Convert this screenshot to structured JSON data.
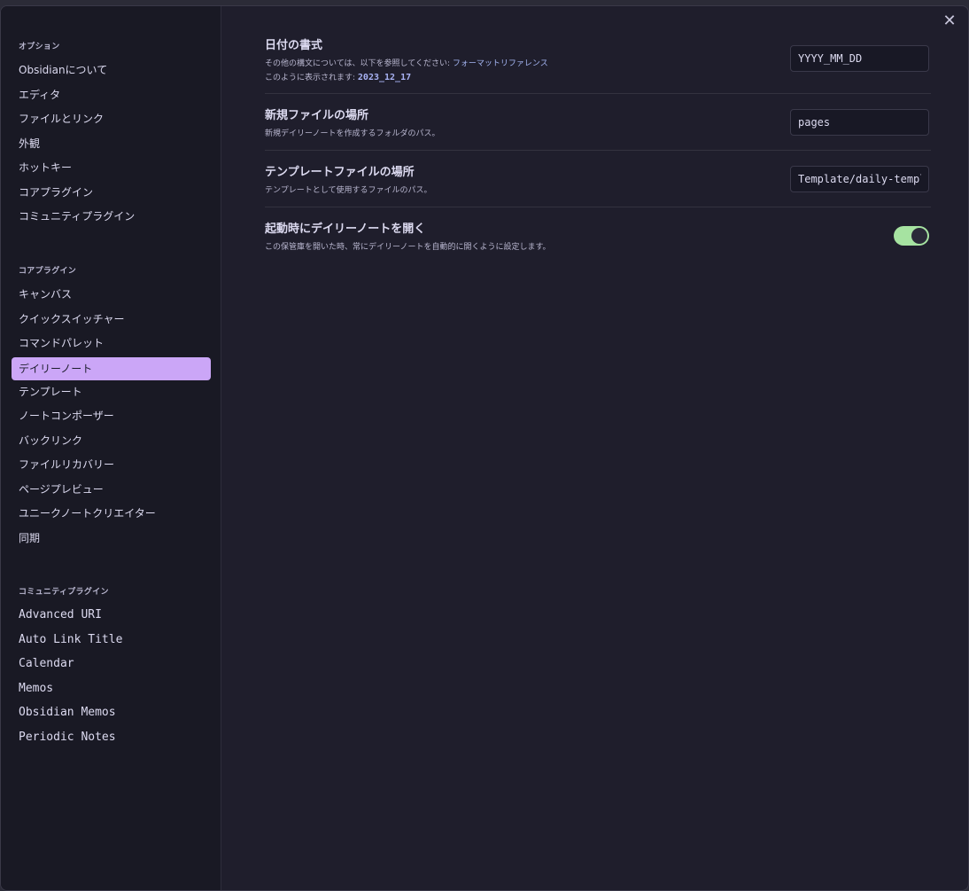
{
  "close_label": "✕",
  "sidebar": {
    "groups": [
      {
        "title": "オプション",
        "items": [
          "Obsidianについて",
          "エディタ",
          "ファイルとリンク",
          "外観",
          "ホットキー",
          "コアプラグイン",
          "コミュニティプラグイン"
        ]
      },
      {
        "title": "コアプラグイン",
        "items": [
          "キャンバス",
          "クイックスイッチャー",
          "コマンドパレット",
          "デイリーノート",
          "テンプレート",
          "ノートコンポーザー",
          "バックリンク",
          "ファイルリカバリー",
          "ページプレビュー",
          "ユニークノートクリエイター",
          "同期"
        ]
      },
      {
        "title": "コミュニティプラグイン",
        "items": [
          "Advanced URI",
          "Auto Link Title",
          "Calendar",
          "Memos",
          "Obsidian Memos",
          "Periodic Notes"
        ]
      }
    ],
    "active_item": "デイリーノート"
  },
  "settings": {
    "date_format": {
      "title": "日付の書式",
      "desc_prefix": "その他の構文については、以下を参照してください: ",
      "desc_link": "フォーマットリファレンス",
      "preview_prefix": "このように表示されます: ",
      "preview_value": "2023_12_17",
      "input_value": "YYYY_MM_DD"
    },
    "new_file_location": {
      "title": "新規ファイルの場所",
      "desc": "新規デイリーノートを作成するフォルダのパス。",
      "input_value": "pages"
    },
    "template_location": {
      "title": "テンプレートファイルの場所",
      "desc": "テンプレートとして使用するファイルのパス。",
      "input_value": "Template/daily-template"
    },
    "open_on_startup": {
      "title": "起動時にデイリーノートを開く",
      "desc": "この保管庫を開いた時、常にデイリーノートを自動的に開くように設定します。",
      "enabled": true
    }
  },
  "colors": {
    "accent": "#cba6f7",
    "toggle_on": "#a6e3a1",
    "link": "#a6b7f5"
  }
}
